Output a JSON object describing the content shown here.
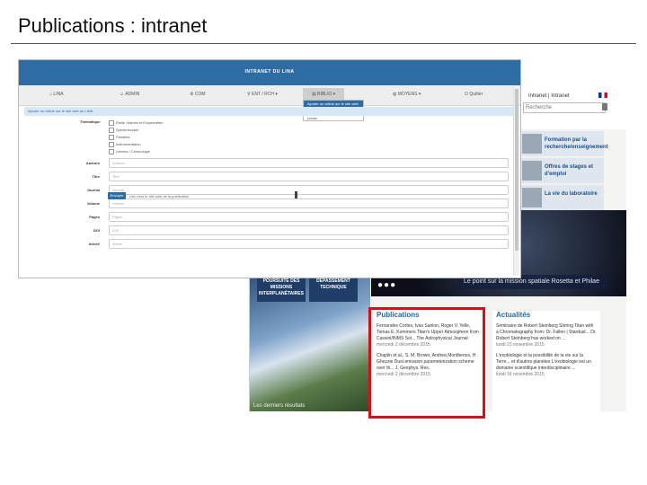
{
  "slide": {
    "title": "Publications : intranet"
  },
  "colors": {
    "intranet_blue": "#2e6da4",
    "highlight_frame": "#d1121b",
    "link_blue": "#1b6aa8"
  },
  "intranet": {
    "header_title": "INTRANET DU LINA",
    "nav": [
      {
        "label": "LINA",
        "icon": "home-icon"
      },
      {
        "label": "ADMIN",
        "icon": "user-icon"
      },
      {
        "label": "COM",
        "icon": "gear-icon"
      },
      {
        "label": "ENT / RCH",
        "icon": "search-icon"
      },
      {
        "label": "BIBLIO",
        "icon": "book-icon"
      },
      {
        "label": "MOYENS",
        "icon": "globe-icon"
      },
      {
        "label": "Quitter",
        "icon": "power-icon"
      }
    ],
    "dropdown": [
      "Ajouter un article sur le site web",
      "Publications",
      "Livres"
    ],
    "breadcrumb": "Ajouter un article sur le site web du LINA",
    "category_label": "Thématique",
    "categories": [
      "Étoile, Naines et Exoplanètes",
      "Spectroscopie",
      "Planètes",
      "Instrumentation",
      "Univers / Cosmologie"
    ],
    "fields": [
      {
        "label": "Auteurs",
        "placeholder": "Auteurs"
      },
      {
        "label": "Titre",
        "placeholder": "Titre"
      },
      {
        "label": "Journal",
        "placeholder": "Journal"
      },
      {
        "label": "Volume",
        "placeholder": "Volume"
      },
      {
        "label": "Pages",
        "placeholder": "Pages"
      },
      {
        "label": "DOI",
        "placeholder": "DOI"
      },
      {
        "label": "Année",
        "placeholder": "Année"
      }
    ],
    "submit_label": "Envoyer",
    "submit_note": "Lien vers le site web de la publication"
  },
  "website": {
    "top_links": "Intranet | Intranet",
    "search_placeholder": "Recherche",
    "banners": [
      "Formation par la recherche/enseignement",
      "Offres de stages et d'emploi",
      "La vie du laboratoire"
    ],
    "space_caption": "Le point sur la mission spatiale Rosetta et Philae",
    "tiles": [
      "POURSUITE DES MISSIONS INTERPLANÉTAIRES",
      "DÉPASSEMENT TECHNIQUE"
    ],
    "cosmos_caption": "Les derniers résultats",
    "publications": {
      "heading": "Publications",
      "item1": "Fernandes Cortes, Ivas Sanlon, Roger V. Yelle, Tomas E. Kommers Titan's Upper Atmosphere from Cassini/INMS Sol... The Astrophysical Journal",
      "date1": "mercredi 2 décembre 2015",
      "item2": "Chaplin et al., S. M. Brown, Andrea Montbenos, H. Ghezzie Dust emission parameterization scheme over th... J. Geophys. Res.",
      "date2": "mercredi 2 décembre 2015"
    },
    "actualites": {
      "heading": "Actualités",
      "item1": "Séminaire de Robert Steinberg Stirring Titan with a Chromatography from: Dr. Fallen | Stardust... Dr. Robert Steinberg has worked on ...",
      "date1": "lundi 23 novembre 2015",
      "item2": "L'exobiologie et la possibilité de la vie sur la Terre... et d'autres planètes L'exobiologie est un domaine scientifique interdisciplinaire ...",
      "date2": "lundi 16 novembre 2015"
    }
  }
}
